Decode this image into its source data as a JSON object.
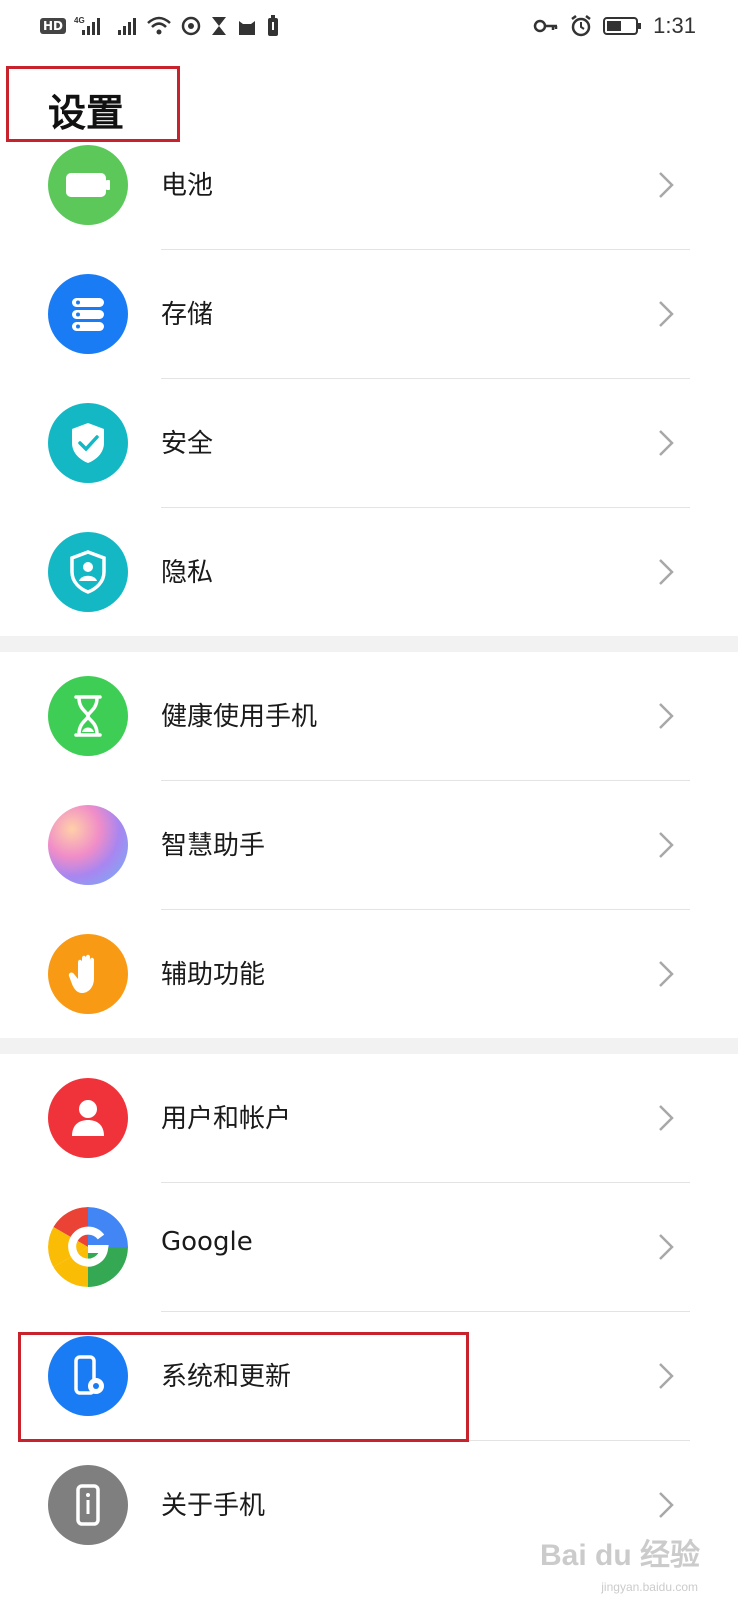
{
  "status_bar": {
    "hd_label": "HD",
    "network_1": "4G",
    "network_2": "4G",
    "time": "1:31",
    "icons": [
      "hd-icon",
      "signal-icon",
      "signal-icon",
      "wifi-icon",
      "sync-icon",
      "hourglass-icon",
      "cat-icon",
      "battery-saver-icon",
      "key-icon",
      "alarm-icon",
      "battery-icon"
    ]
  },
  "header": {
    "title": "设置"
  },
  "settings": {
    "items": [
      {
        "label": "电池",
        "icon": "battery-icon",
        "color": "#5cc85a"
      },
      {
        "label": "存储",
        "icon": "storage-icon",
        "color": "#1a7cf5"
      },
      {
        "label": "安全",
        "icon": "shield-check-icon",
        "color": "#13b8c4"
      },
      {
        "label": "隐私",
        "icon": "privacy-icon",
        "color": "#13b8c4"
      },
      {
        "label": "健康使用手机",
        "icon": "hourglass-icon",
        "color": "#3fce55"
      },
      {
        "label": "智慧助手",
        "icon": "assistant-icon",
        "color": "#b08cf0"
      },
      {
        "label": "辅助功能",
        "icon": "hand-icon",
        "color": "#f99a14"
      },
      {
        "label": "用户和帐户",
        "icon": "user-icon",
        "color": "#f0333b"
      },
      {
        "label": "Google",
        "icon": "google-icon",
        "color": "#4285f4"
      },
      {
        "label": "系统和更新",
        "icon": "system-update-icon",
        "color": "#1a7cf5"
      },
      {
        "label": "关于手机",
        "icon": "phone-info-icon",
        "color": "#7f7f7f"
      }
    ]
  },
  "watermark": {
    "text": "Bai du 经验",
    "sub": "jingyan.baidu.com"
  }
}
